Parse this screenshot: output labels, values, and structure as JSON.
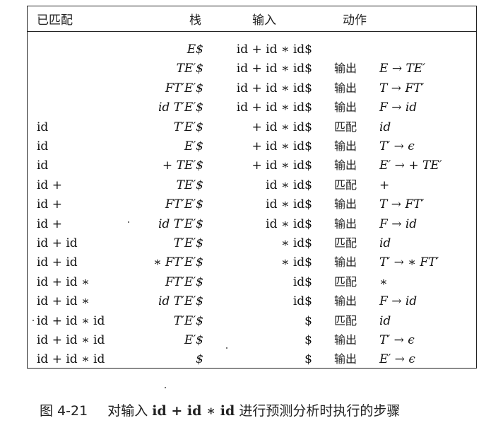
{
  "table": {
    "headers": {
      "matched": "已匹配",
      "stack": "栈",
      "input": "输入",
      "action": "动作"
    },
    "rows": [
      {
        "matched": "",
        "stack": "E$",
        "input": "id + id ∗ id$",
        "action_kind": "",
        "action_detail": ""
      },
      {
        "matched": "",
        "stack": "TE′$",
        "input": "id + id ∗ id$",
        "action_kind": "输出",
        "action_detail": "E → TE′"
      },
      {
        "matched": "",
        "stack": "FT′E′$",
        "input": "id + id ∗ id$",
        "action_kind": "输出",
        "action_detail": "T → FT′"
      },
      {
        "matched": "",
        "stack": "id T′E′$",
        "input": "id + id ∗ id$",
        "action_kind": "输出",
        "action_detail": "F → id"
      },
      {
        "matched": "id",
        "stack": "T′E′$",
        "input": "+ id ∗ id$",
        "action_kind": "匹配",
        "action_detail": "id"
      },
      {
        "matched": "id",
        "stack": "E′$",
        "input": "+ id ∗ id$",
        "action_kind": "输出",
        "action_detail": "T′ → ϵ"
      },
      {
        "matched": "id",
        "stack": "+ TE′$",
        "input": "+ id ∗ id$",
        "action_kind": "输出",
        "action_detail": "E′ → + TE′"
      },
      {
        "matched": "id +",
        "stack": "TE′$",
        "input": "id ∗ id$",
        "action_kind": "匹配",
        "action_detail": "+"
      },
      {
        "matched": "id +",
        "stack": "FT′E′$",
        "input": "id ∗ id$",
        "action_kind": "输出",
        "action_detail": "T → FT′"
      },
      {
        "matched": "id +",
        "stack": "id T′E′$",
        "input": "id ∗ id$",
        "action_kind": "输出",
        "action_detail": "F → id"
      },
      {
        "matched": "id + id",
        "stack": "T′E′$",
        "input": "∗ id$",
        "action_kind": "匹配",
        "action_detail": "id"
      },
      {
        "matched": "id + id",
        "stack": "∗ FT′E′$",
        "input": "∗ id$",
        "action_kind": "输出",
        "action_detail": "T′ → ∗ FT′"
      },
      {
        "matched": "id + id ∗",
        "stack": "FT′E′$",
        "input": "id$",
        "action_kind": "匹配",
        "action_detail": "∗"
      },
      {
        "matched": "id + id ∗",
        "stack": "id T′E′$",
        "input": "id$",
        "action_kind": "输出",
        "action_detail": "F → id"
      },
      {
        "matched": "id + id ∗ id",
        "stack": "T′E′$",
        "input": "$",
        "action_kind": "匹配",
        "action_detail": "id"
      },
      {
        "matched": "id + id ∗ id",
        "stack": "E′$",
        "input": "$",
        "action_kind": "输出",
        "action_detail": "T′ → ϵ"
      },
      {
        "matched": "id + id ∗ id",
        "stack": "$",
        "input": "$",
        "action_kind": "输出",
        "action_detail": "E′ → ϵ"
      }
    ]
  },
  "caption": {
    "figure_number": "图 4-21",
    "text_before": "对输入",
    "expression": "id + id ∗ id",
    "text_after": "进行预测分析时执行的步骤"
  }
}
